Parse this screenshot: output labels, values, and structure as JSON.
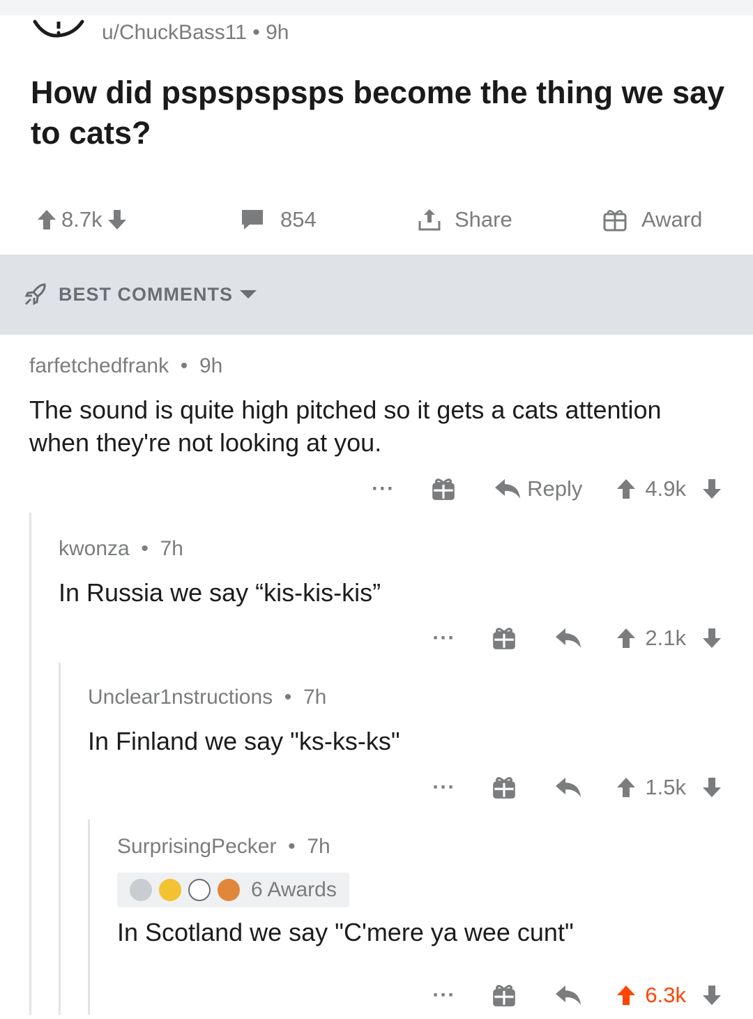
{
  "post": {
    "author": "u/ChuckBass11",
    "age": "9h",
    "title": "How did pspspspsps become the thing we say to cats?",
    "votes": "8.7k",
    "comments": "854",
    "share_label": "Share",
    "award_label": "Award"
  },
  "sort": {
    "label": "BEST COMMENTS"
  },
  "comments": [
    {
      "author": "farfetchedfrank",
      "age": "9h",
      "body": "The sound is quite high pitched so it gets a cats attention when they're not looking at you.",
      "score": "4.9k",
      "reply_label": "Reply"
    },
    {
      "author": "kwonza",
      "age": "7h",
      "body": "In Russia we say “kis-kis-kis”",
      "score": "2.1k"
    },
    {
      "author": "Unclear1nstructions",
      "age": "7h",
      "body": "In Finland we say \"ks-ks-ks\"",
      "score": "1.5k"
    },
    {
      "author": "SurprisingPecker",
      "age": "7h",
      "awards": "6 Awards",
      "body": "In Scotland we say \"C'mere ya wee cunt\"",
      "score": "6.3k"
    }
  ],
  "colors": {
    "upvoted": "#ff4500",
    "meta": "#7a7c7e",
    "sortbar": "#dfe3e8"
  },
  "icons": [
    "upvote-arrow-icon",
    "downvote-arrow-icon",
    "comment-bubble-icon",
    "share-icon",
    "gift-icon",
    "rocket-icon",
    "caret-down-icon",
    "reply-arrow-icon",
    "more-dots-icon"
  ]
}
